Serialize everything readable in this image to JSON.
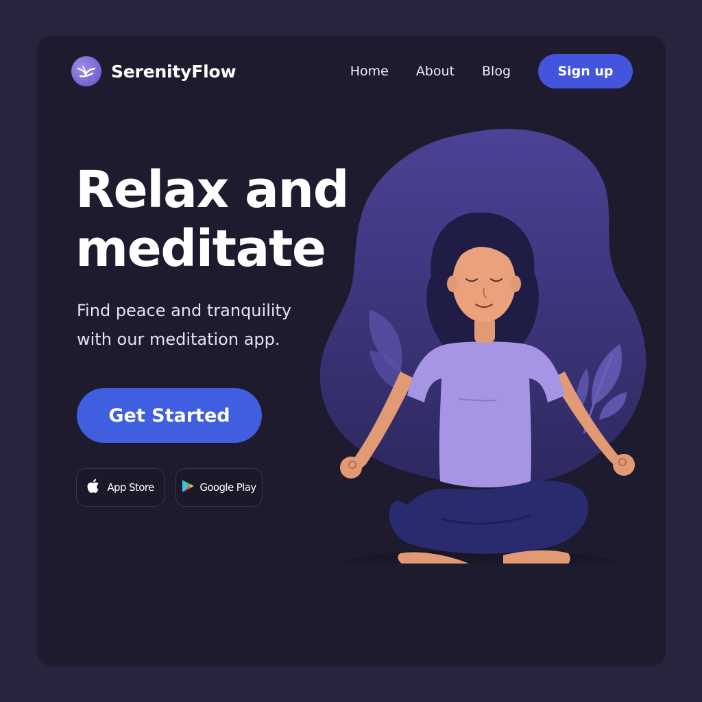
{
  "brand": {
    "name": "SerenityFlow",
    "logo_icon": "flowing-bird-icon",
    "accent": "#4454dc"
  },
  "nav": {
    "links": [
      "Home",
      "About",
      "Blog"
    ],
    "signup_label": "Sign up"
  },
  "hero": {
    "headline": "Relax and meditate",
    "subtitle": "Find peace and tranquility with our meditation app.",
    "cta_label": "Get Started",
    "cta_color": "#3f5ee0"
  },
  "stores": [
    {
      "label": "App Store",
      "icon": "apple-icon"
    },
    {
      "label": "Google Play",
      "icon": "google-play-icon"
    }
  ],
  "illustration": {
    "subject": "woman-meditating-illustration",
    "shirt_color": "#a694e4",
    "pants_color": "#2a2b6e",
    "backdrop_color": "#3f3781"
  }
}
